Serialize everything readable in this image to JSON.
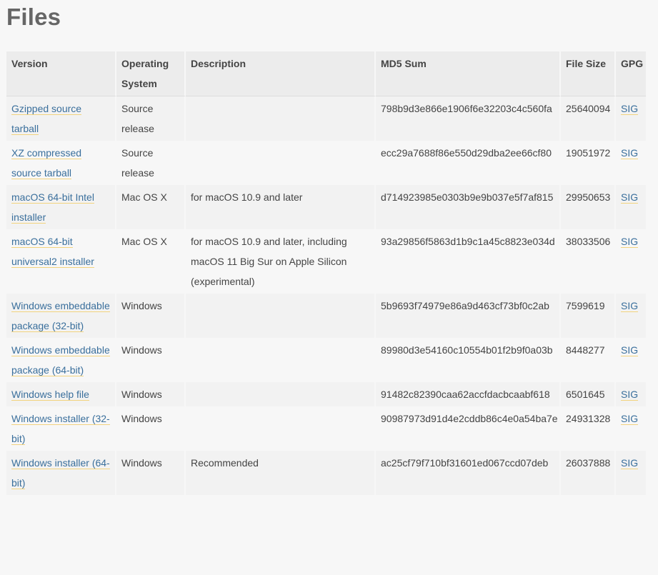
{
  "page": {
    "title": "Files"
  },
  "table": {
    "headers": {
      "version": "Version",
      "os": "Operating System",
      "description": "Description",
      "md5": "MD5 Sum",
      "size": "File Size",
      "gpg": "GPG"
    },
    "rows": [
      {
        "version": "Gzipped source tarball",
        "os": "Source release",
        "description": "",
        "md5": "798b9d3e866e1906f6e32203c4c560fa",
        "size": "25640094",
        "gpg": "SIG"
      },
      {
        "version": "XZ compressed source tarball",
        "os": "Source release",
        "description": "",
        "md5": "ecc29a7688f86e550d29dba2ee66cf80",
        "size": "19051972",
        "gpg": "SIG"
      },
      {
        "version": "macOS 64-bit Intel installer",
        "os": "Mac OS X",
        "description": "for macOS 10.9 and later",
        "md5": "d714923985e0303b9e9b037e5f7af815",
        "size": "29950653",
        "gpg": "SIG"
      },
      {
        "version": "macOS 64-bit universal2 installer",
        "os": "Mac OS X",
        "description": "for macOS 10.9 and later, including macOS 11 Big Sur on Apple Silicon (experimental)",
        "md5": "93a29856f5863d1b9c1a45c8823e034d",
        "size": "38033506",
        "gpg": "SIG"
      },
      {
        "version": "Windows embeddable package (32-bit)",
        "os": "Windows",
        "description": "",
        "md5": "5b9693f74979e86a9d463cf73bf0c2ab",
        "size": "7599619",
        "gpg": "SIG"
      },
      {
        "version": "Windows embeddable package (64-bit)",
        "os": "Windows",
        "description": "",
        "md5": "89980d3e54160c10554b01f2b9f0a03b",
        "size": "8448277",
        "gpg": "SIG"
      },
      {
        "version": "Windows help file",
        "os": "Windows",
        "description": "",
        "md5": "91482c82390caa62accfdacbcaabf618",
        "size": "6501645",
        "gpg": "SIG"
      },
      {
        "version": "Windows installer (32-bit)",
        "os": "Windows",
        "description": "",
        "md5": "90987973d91d4e2cddb86c4e0a54ba7e",
        "size": "24931328",
        "gpg": "SIG"
      },
      {
        "version": "Windows installer (64-bit)",
        "os": "Windows",
        "description": "Recommended",
        "md5": "ac25cf79f710bf31601ed067ccd07deb",
        "size": "26037888",
        "gpg": "SIG"
      }
    ]
  },
  "colors": {
    "link": "#3a6f9c",
    "link_underline": "#f2d37e",
    "header_bg": "#ececec",
    "row_odd_bg": "#f2f2f2",
    "page_bg": "#f7f7f7"
  }
}
